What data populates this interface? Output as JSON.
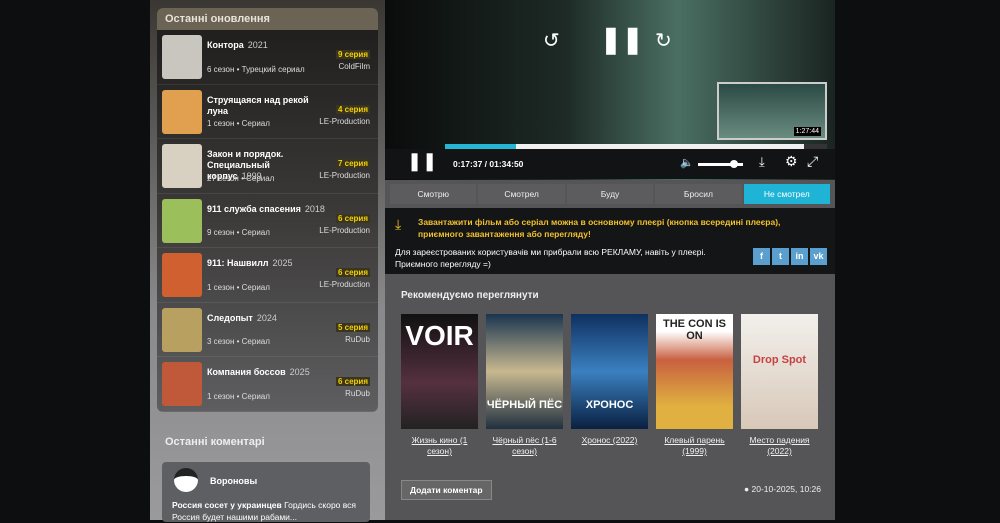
{
  "sidebar": {
    "updates_title": "Останні оновлення",
    "items": [
      {
        "title": "Контора",
        "year": "2021",
        "meta": "6 сезон • Турецкий сериал",
        "episode": "9 серия",
        "source": "ColdFilm"
      },
      {
        "title": "Струящаяся над рекой луна",
        "year": "",
        "meta": "1 сезон • Сериал",
        "episode": "4 серия",
        "source": "LE-Production"
      },
      {
        "title": "Закон и порядок. Специальный корпус",
        "year": "1999",
        "meta": "27 сезон • Сериал",
        "episode": "7 серия",
        "source": "LE-Production"
      },
      {
        "title": "911 служба спасения",
        "year": "2018",
        "meta": "9 сезон • Сериал",
        "episode": "6 серия",
        "source": "LE-Production"
      },
      {
        "title": "911: Нашвилл",
        "year": "2025",
        "meta": "1 сезон • Сериал",
        "episode": "6 серия",
        "source": "LE-Production"
      },
      {
        "title": "Следопыт",
        "year": "2024",
        "meta": "3 сезон • Сериал",
        "episode": "5 серия",
        "source": "RuDub"
      },
      {
        "title": "Компания боссов",
        "year": "2025",
        "meta": "1 сезон • Сериал",
        "episode": "6 серия",
        "source": "RuDub"
      }
    ],
    "comments_title": "Останні коментарі",
    "comment": {
      "author": "Вороновы",
      "bold": "Россия сосет у украинцев",
      "text": " Гордись скоро вся Россия будет нашими рабами..."
    }
  },
  "player": {
    "time": "0:17:37 / 01:34:50",
    "preview_time": "1:27:44",
    "progress_played": 0.185,
    "progress_buffered": 0.94,
    "volume": 0.8
  },
  "tabs": [
    "Смотрю",
    "Смотрел",
    "Буду",
    "Бросил",
    "Не смотрел"
  ],
  "active_tab": 4,
  "notice": {
    "download": "Завантажити фільм або серіал можна в основному плеєрі (кнопка всередині плеєра), приємного завантаження або перегляду!",
    "ads": "Для зареєстрованих користувачів ми прибрали всю РЕКЛАМУ, навіть у плеєрі. Приємного перегляду =)"
  },
  "social": [
    "f",
    "t",
    "in",
    "vk"
  ],
  "recommend": {
    "title": "Рекомендуємо переглянути",
    "items": [
      {
        "label": "Жизнь кино (1 сезон)",
        "poster_text": "VOIR"
      },
      {
        "label": "Чёрный пёс (1-6 сезон)",
        "poster_text": "ЧЁРНЫЙ ПЁС"
      },
      {
        "label": "Хронос (2022)",
        "poster_text": "ХРОНОС"
      },
      {
        "label": "Клевый парень (1999)",
        "poster_text": "THE CON IS ON"
      },
      {
        "label": "Место падения (2022)",
        "poster_text": "Drop Spot"
      }
    ]
  },
  "add_comment": "Додати коментар",
  "date": "20-10-2025, 10:26"
}
